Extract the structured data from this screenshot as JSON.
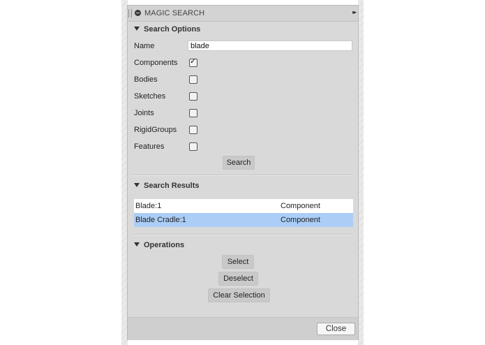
{
  "window": {
    "title": "MAGIC SEARCH",
    "expand_glyph": "▸▸"
  },
  "search_options": {
    "header": "Search Options",
    "name_label": "Name",
    "name_value": "blade",
    "checkboxes": [
      {
        "label": "Components",
        "checked": true
      },
      {
        "label": "Bodies",
        "checked": false
      },
      {
        "label": "Sketches",
        "checked": false
      },
      {
        "label": "Joints",
        "checked": false
      },
      {
        "label": "RigidGroups",
        "checked": false
      },
      {
        "label": "Features",
        "checked": false
      }
    ],
    "search_button": "Search"
  },
  "search_results": {
    "header": "Search Results",
    "rows": [
      {
        "name": "Blade:1",
        "type": "Component",
        "selected": false
      },
      {
        "name": "Blade Cradle:1",
        "type": "Component",
        "selected": true
      }
    ]
  },
  "operations": {
    "header": "Operations",
    "select_button": "Select",
    "deselect_button": "Deselect",
    "clear_button": "Clear Selection"
  },
  "footer": {
    "close_button": "Close"
  },
  "colors": {
    "selection": "#abcdf6",
    "panel_bg": "#d9d9d9"
  }
}
